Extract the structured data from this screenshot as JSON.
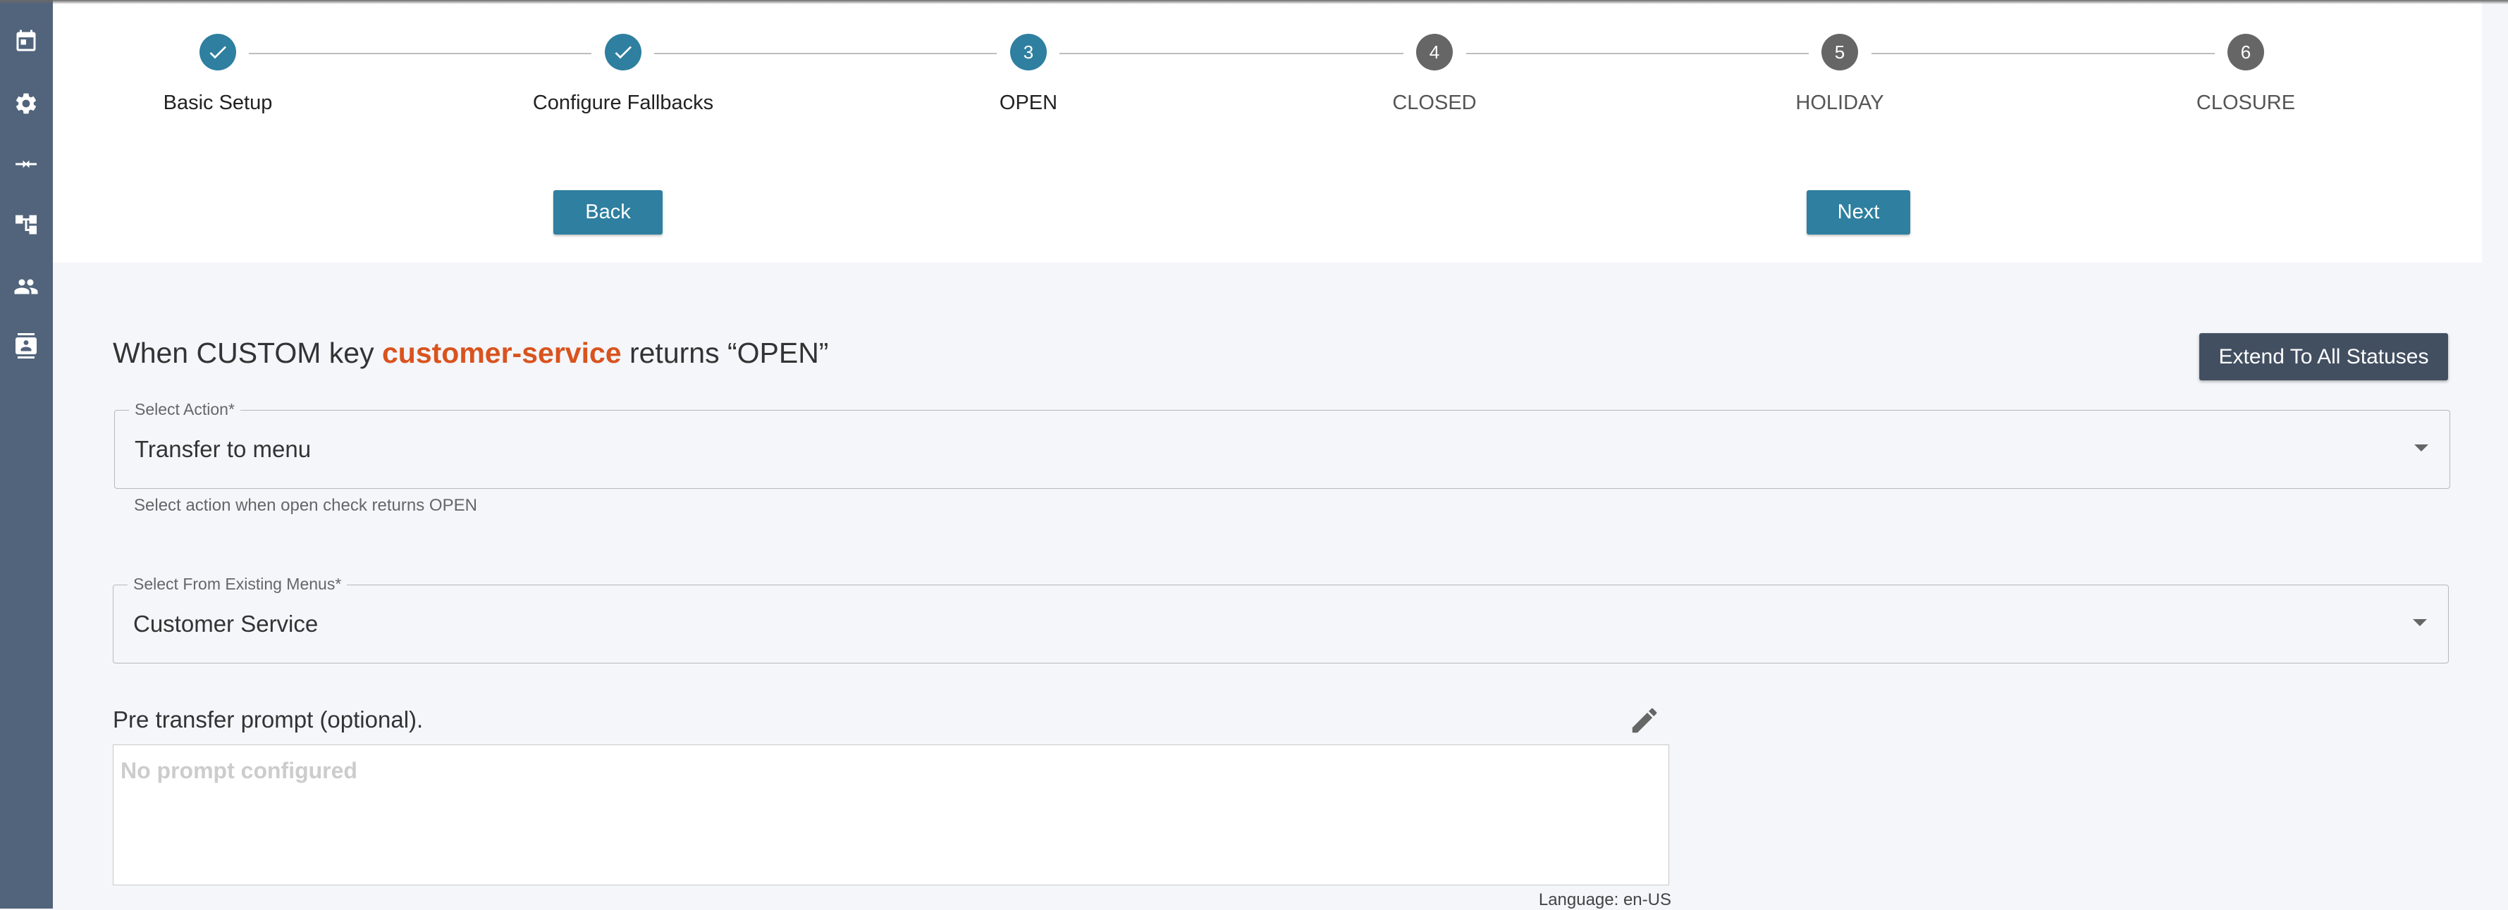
{
  "sidebar": {
    "items": [
      {
        "icon": "calendar-icon"
      },
      {
        "icon": "gear-icon"
      },
      {
        "icon": "transfer-arrows-icon"
      },
      {
        "icon": "tree-structure-icon"
      },
      {
        "icon": "people-icon"
      },
      {
        "icon": "contact-card-icon"
      }
    ]
  },
  "stepper": {
    "steps": [
      {
        "number": "1",
        "label": "Basic Setup",
        "status": "completed"
      },
      {
        "number": "2",
        "label": "Configure Fallbacks",
        "status": "completed"
      },
      {
        "number": "3",
        "label": "OPEN",
        "status": "active"
      },
      {
        "number": "4",
        "label": "CLOSED",
        "status": "pending"
      },
      {
        "number": "5",
        "label": "HOLIDAY",
        "status": "pending"
      },
      {
        "number": "6",
        "label": "CLOSURE",
        "status": "pending"
      }
    ],
    "back_label": "Back",
    "next_label": "Next"
  },
  "section": {
    "title_prefix": "When CUSTOM key ",
    "key_name": "customer-service",
    "title_suffix": " returns “OPEN”",
    "extend_label": "Extend To All Statuses"
  },
  "action_select": {
    "label": "Select Action*",
    "value": "Transfer to menu",
    "helper": "Select action when open check returns OPEN"
  },
  "menu_select": {
    "label": "Select From Existing Menus*",
    "value": "Customer Service"
  },
  "prompt": {
    "label": "Pre transfer prompt (optional).",
    "placeholder": "No prompt configured",
    "language": "Language: en-US"
  },
  "colors": {
    "primary": "#2e7fa0",
    "sidebar": "#51647c",
    "accent": "#d9531e",
    "dark_button": "#424f61"
  }
}
